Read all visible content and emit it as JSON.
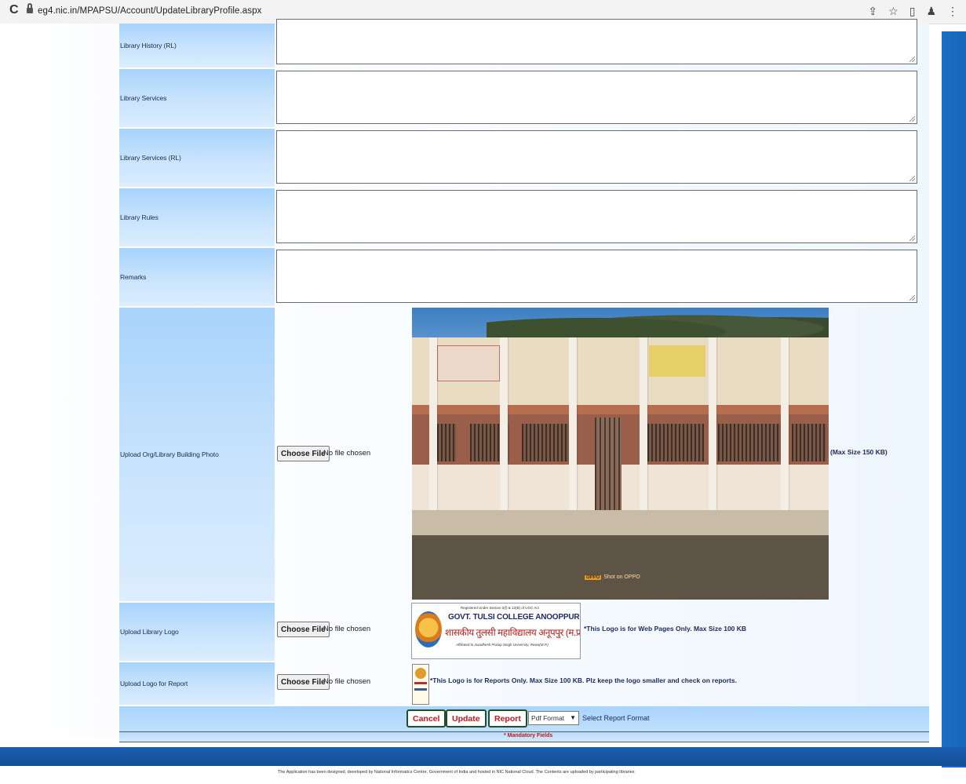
{
  "browser": {
    "reload_glyph": "C",
    "url": "eg4.nic.in/MPAPSU/Account/UpdateLibraryProfile.aspx",
    "icons": [
      "share-icon",
      "bookmark-star-icon",
      "sidepanel-icon",
      "profile-icon",
      "menu-icon"
    ]
  },
  "form": {
    "rows": [
      {
        "label": "Library History (RL)"
      },
      {
        "label": "Library Services"
      },
      {
        "label": "Library Services (RL)"
      },
      {
        "label": "Library Rules"
      },
      {
        "label": "Remarks"
      }
    ],
    "building_photo": {
      "label": "Upload Org/Library Building Photo",
      "button": "Choose File",
      "status": "No file chosen",
      "note": "(Max Size 150 KB)",
      "watermark": "Shot on OPPO"
    },
    "library_logo": {
      "label": "Upload Library Logo",
      "button": "Choose File",
      "status": "No file chosen",
      "note": "*This Logo is for Web Pages Only. Max Size 100 KB",
      "logo_text": {
        "line1": "Registered Under Section 2(f) & 12(B) of UGC Act",
        "line2": "GOVT. TULSI COLLEGE ANOOPPUR,(M.P)",
        "line3": "शासकीय तुलसी महाविद्यालय अनूपपुर (म.प्र.)",
        "line4": "Affiliated to Awadhesh Pratap Singh University, Rewa(M.P.)"
      }
    },
    "report_logo": {
      "label": "Upload Logo for Report",
      "button": "Choose File",
      "status": "No file chosen",
      "note": "*This Logo is for Reports Only. Max Size 100 KB. Plz keep the logo smaller and check on reports."
    }
  },
  "actions": {
    "cancel": "Cancel",
    "update": "Update",
    "report": "Report",
    "format_selected": "Pdf Format",
    "format_note": "Select Report Format"
  },
  "mandatory_note": "* Mandatory Fields",
  "footer": {
    "text": "The Application has been designed, developed by National Informatics Centre, Government of India and hosted in NIC National Cloud. The Contents are uploaded by participating libraries"
  },
  "colors": {
    "label_bg": "#b9dcfb",
    "action_text": "#c4161c",
    "footer_band": "#1a5fb0"
  }
}
